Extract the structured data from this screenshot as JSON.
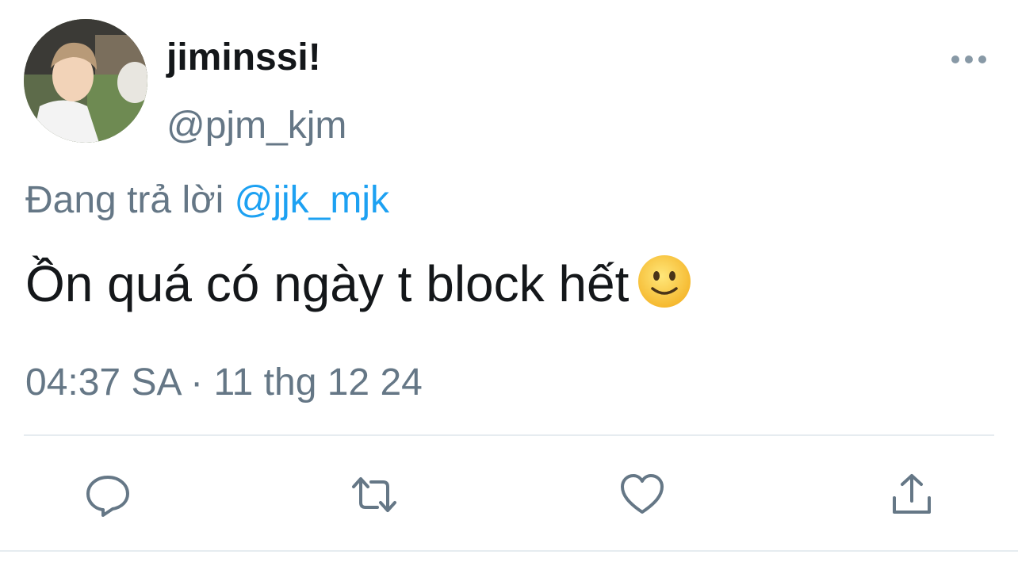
{
  "tweet": {
    "display_name": "jiminssi!",
    "handle": "@pjm_kjm",
    "reply_prefix": "Đang trả lời",
    "reply_to": "@jjk_mjk",
    "text": "Ồn quá có ngày t block hết",
    "emoji": "slightly-smiling-face",
    "timestamp": "04:37 SA · 11 thg 12 24"
  },
  "actions": [
    {
      "name": "reply",
      "icon": "reply-icon"
    },
    {
      "name": "retweet",
      "icon": "retweet-icon"
    },
    {
      "name": "like",
      "icon": "heart-icon"
    },
    {
      "name": "share",
      "icon": "share-icon"
    }
  ],
  "colors": {
    "text": "#14171a",
    "secondary": "#657786",
    "link": "#1da1f2",
    "divider": "#e6ecf0"
  }
}
